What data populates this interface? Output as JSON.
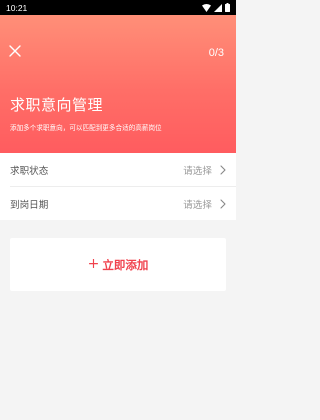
{
  "status_bar": {
    "time": "10:21",
    "icons": [
      "wifi-icon",
      "signal-icon",
      "battery-icon"
    ]
  },
  "header": {
    "close_icon": "close-icon",
    "progress": "0/3",
    "title": "求职意向管理",
    "subtitle": "添加多个求职意向，可以匹配到更多合适的高薪岗位"
  },
  "form": {
    "rows": [
      {
        "label": "求职状态",
        "value": "请选择",
        "icon": "chevron-right-icon"
      },
      {
        "label": "到岗日期",
        "value": "请选择",
        "icon": "chevron-right-icon"
      }
    ]
  },
  "add_button": {
    "icon": "plus-icon",
    "label": "立即添加"
  },
  "colors": {
    "header_gradient_top": "#ff8f78",
    "header_gradient_bottom": "#ff5c5f",
    "accent": "#f0424d",
    "background": "#f4f4f4"
  }
}
